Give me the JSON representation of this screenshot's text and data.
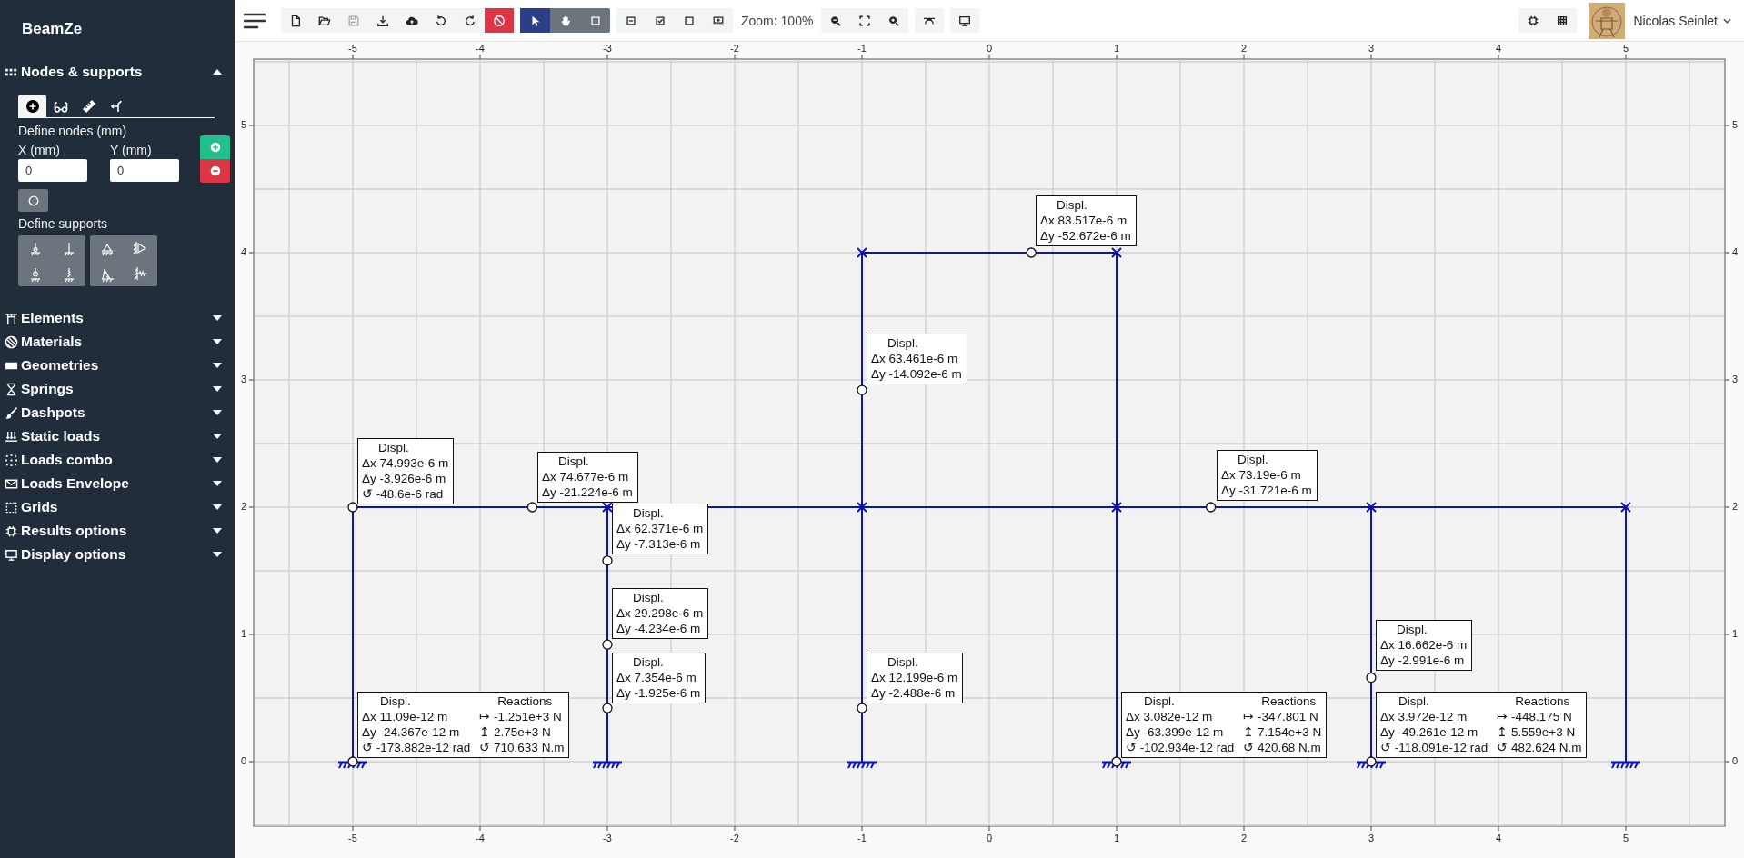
{
  "app": {
    "title": "BeamZe"
  },
  "sidebar": {
    "sections": [
      {
        "label": "Nodes & supports",
        "expanded": true
      },
      {
        "label": "Elements",
        "expanded": false
      },
      {
        "label": "Materials",
        "expanded": false
      },
      {
        "label": "Geometries",
        "expanded": false
      },
      {
        "label": "Springs",
        "expanded": false
      },
      {
        "label": "Dashpots",
        "expanded": false
      },
      {
        "label": "Static loads",
        "expanded": false
      },
      {
        "label": "Loads combo",
        "expanded": false
      },
      {
        "label": "Loads Envelope",
        "expanded": false
      },
      {
        "label": "Grids",
        "expanded": false
      },
      {
        "label": "Results options",
        "expanded": false
      },
      {
        "label": "Display options",
        "expanded": false
      }
    ]
  },
  "node_panel": {
    "tabs": [
      {
        "kind": "add",
        "selected": true
      },
      {
        "kind": "view",
        "selected": false
      },
      {
        "kind": "measure",
        "selected": false
      },
      {
        "kind": "connect",
        "selected": false
      }
    ],
    "heading": "Define nodes (mm)",
    "fields": [
      {
        "label": "X (mm)",
        "value": "0"
      },
      {
        "label": "Y (mm)",
        "value": "0"
      }
    ],
    "supports_heading": "Define supports"
  },
  "toolbar": {
    "file_actions": [
      {
        "kind": "new",
        "disabled": false
      },
      {
        "kind": "open",
        "disabled": false
      },
      {
        "kind": "save",
        "disabled": true
      },
      {
        "kind": "download",
        "disabled": false
      },
      {
        "kind": "upload",
        "disabled": false
      },
      {
        "kind": "undo",
        "disabled": false
      },
      {
        "kind": "redo",
        "disabled": false
      },
      {
        "kind": "stop",
        "disabled": false
      }
    ],
    "modes": [
      {
        "kind": "select",
        "selected": true
      },
      {
        "kind": "pan",
        "selected": false
      },
      {
        "kind": "box",
        "selected": false
      }
    ],
    "zoom_label": "Zoom: 100%"
  },
  "user": {
    "name": "Nicolas Seinlet"
  },
  "canvas": {
    "top_ticks": [
      "-5",
      "-4",
      "-3",
      "-2",
      "-1",
      "0",
      "1",
      "2",
      "3",
      "4",
      "5"
    ],
    "bottom_ticks": [
      "-5",
      "-4",
      "-3",
      "-2",
      "-1",
      "0",
      "1",
      "2",
      "3",
      "4",
      "5"
    ],
    "left_ticks": [
      "5",
      "4",
      "3",
      "2",
      "1",
      "0"
    ],
    "right_ticks": [
      "5",
      "4",
      "3",
      "2",
      "1",
      "0"
    ],
    "results": [
      {
        "kind": "displacement",
        "title": "Displ.",
        "lines": [
          "Δx 83.517e-6 m",
          "Δy -52.672e-6 m"
        ]
      },
      {
        "kind": "displacement",
        "title": "Displ.",
        "lines": [
          "Δx 63.461e-6 m",
          "Δy -14.092e-6 m"
        ]
      },
      {
        "kind": "displacement",
        "title": "Displ.",
        "lines": [
          "Δx 74.993e-6 m",
          "Δy -3.926e-6 m",
          "↺ -48.6e-6 rad"
        ]
      },
      {
        "kind": "displacement",
        "title": "Displ.",
        "lines": [
          "Δx 74.677e-6 m",
          "Δy -21.224e-6 m"
        ]
      },
      {
        "kind": "displacement",
        "title": "Displ.",
        "lines": [
          "Δx 73.19e-6 m",
          "Δy -31.721e-6 m"
        ]
      },
      {
        "kind": "displacement",
        "title": "Displ.",
        "lines": [
          "Δx 62.371e-6 m",
          "Δy -7.313e-6 m"
        ]
      },
      {
        "kind": "displacement",
        "title": "Displ.",
        "lines": [
          "Δx 29.298e-6 m",
          "Δy -4.234e-6 m"
        ]
      },
      {
        "kind": "displacement",
        "title": "Displ.",
        "lines": [
          "Δx 16.662e-6 m",
          "Δy -2.991e-6 m"
        ]
      },
      {
        "kind": "displacement",
        "title": "Displ.",
        "lines": [
          "Δx 7.354e-6 m",
          "Δy -1.925e-6 m"
        ]
      },
      {
        "kind": "displacement",
        "title": "Displ.",
        "lines": [
          "Δx 12.199e-6 m",
          "Δy -2.488e-6 m"
        ]
      },
      {
        "kind": "support",
        "title": "Displ.",
        "lines": [
          "Δx 11.09e-12 m",
          "Δy -24.367e-12 m",
          "↺ -173.882e-12 rad"
        ],
        "reactions_title": "Reactions",
        "reactions": [
          "↦ -1.251e+3 N",
          "↥ 2.75e+3 N",
          "↺ 710.633 N.m"
        ]
      },
      {
        "kind": "support",
        "title": "Displ.",
        "lines": [
          "Δx 3.082e-12 m",
          "Δy -63.399e-12 m",
          "↺ -102.934e-12 rad"
        ],
        "reactions_title": "Reactions",
        "reactions": [
          "↦ -347.801 N",
          "↥ 7.154e+3 N",
          "↺ 420.68 N.m"
        ]
      },
      {
        "kind": "support",
        "title": "Displ.",
        "lines": [
          "Δx 3.972e-12 m",
          "Δy -49.261e-12 m",
          "↺ -118.091e-12 rad"
        ],
        "reactions_title": "Reactions",
        "reactions": [
          "↦ -448.175 N",
          "↥ 5.559e+3 N",
          "↺ 482.624 N.m"
        ]
      }
    ]
  }
}
